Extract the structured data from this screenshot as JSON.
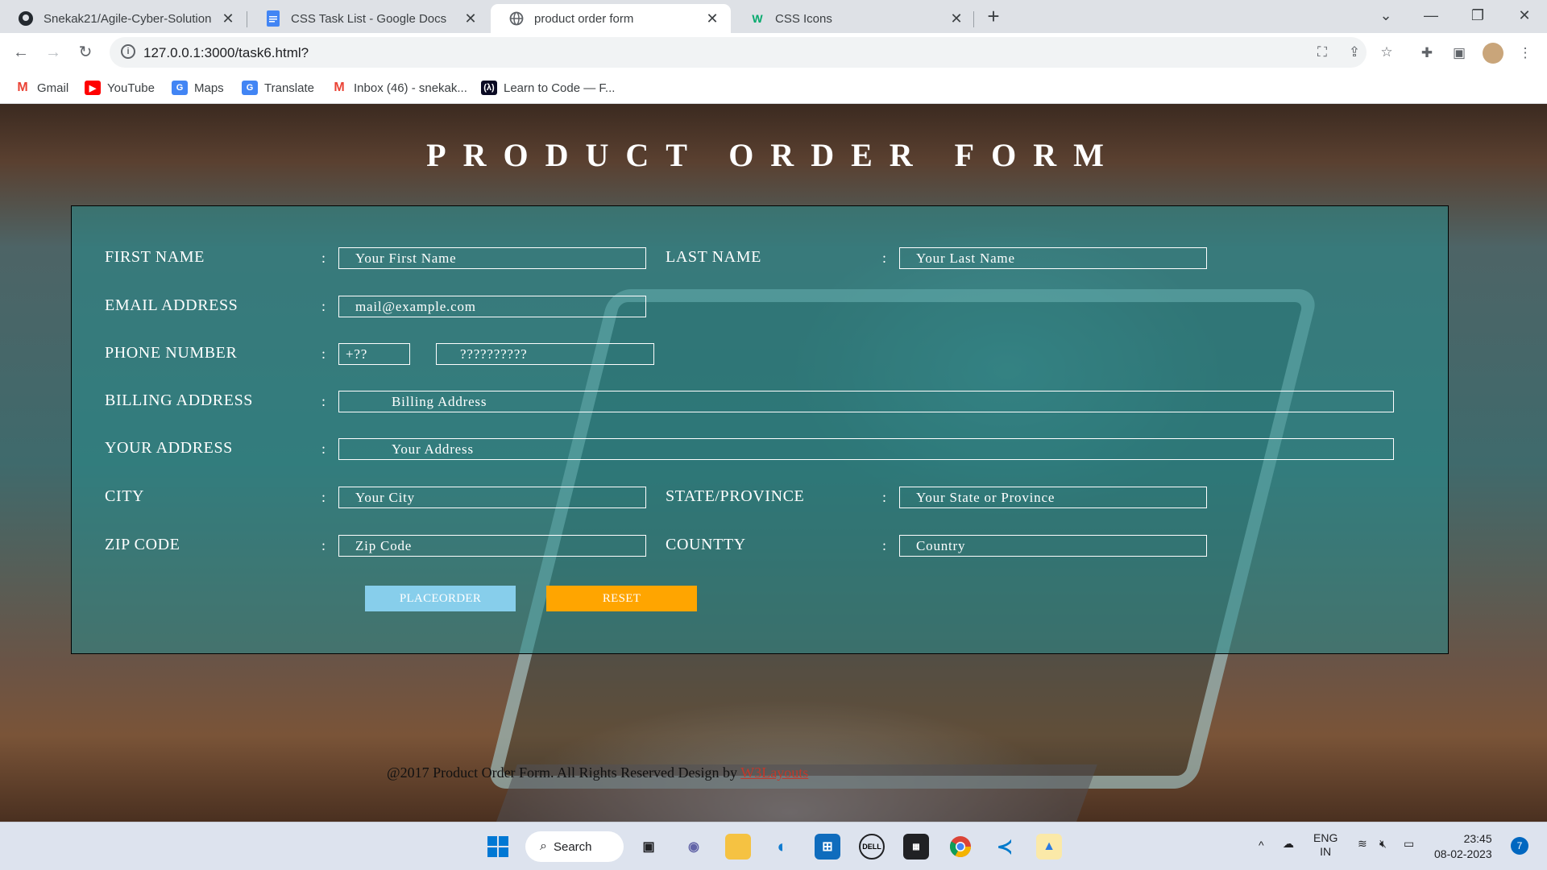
{
  "browser": {
    "tabs": [
      {
        "title": "Snekak21/Agile-Cyber-Solution",
        "icon": "github-icon",
        "active": false
      },
      {
        "title": "CSS Task List - Google Docs",
        "icon": "docs-icon",
        "active": false
      },
      {
        "title": "product order form",
        "icon": "globe-icon",
        "active": true
      },
      {
        "title": "CSS Icons",
        "icon": "w3schools-icon",
        "active": false
      }
    ],
    "url": "127.0.0.1:3000/task6.html?",
    "bookmarks": [
      {
        "label": "Gmail",
        "icon": "gmail-icon",
        "color": "#ea4335"
      },
      {
        "label": "YouTube",
        "icon": "youtube-icon",
        "color": "#ff0000"
      },
      {
        "label": "Maps",
        "icon": "maps-icon",
        "color": "#4285f4"
      },
      {
        "label": "Translate",
        "icon": "translate-icon",
        "color": "#4285f4"
      },
      {
        "label": "Inbox (46) - snekak...",
        "icon": "gmail-icon",
        "color": "#ea4335"
      },
      {
        "label": "Learn to Code — F...",
        "icon": "freecodecamp-icon",
        "color": "#0a0a23"
      }
    ]
  },
  "page": {
    "title": "PRODUCT ORDER FORM",
    "fields": {
      "first_name": {
        "label": "FIRST NAME",
        "placeholder": "Your First Name"
      },
      "last_name": {
        "label": "LAST NAME",
        "placeholder": "Your Last Name"
      },
      "email": {
        "label": "EMAIL ADDRESS",
        "placeholder": "mail@example.com"
      },
      "phone": {
        "label": "PHONE NUMBER",
        "code_placeholder": "+??",
        "number_placeholder": "??????????"
      },
      "billing": {
        "label": "BILLING ADDRESS",
        "placeholder": "Billing Address"
      },
      "address": {
        "label": "YOUR ADDRESS",
        "placeholder": "Your Address"
      },
      "city": {
        "label": "CITY",
        "placeholder": "Your City"
      },
      "state": {
        "label": "STATE/PROVINCE",
        "placeholder": "Your State or Province"
      },
      "zip": {
        "label": "ZIP CODE",
        "placeholder": "Zip Code"
      },
      "country": {
        "label": "COUNTTY",
        "placeholder": "Country"
      }
    },
    "colon": ":",
    "buttons": {
      "place_order": "PLACEORDER",
      "reset": "RESET"
    },
    "colors": {
      "place_order": "#87ceeb",
      "reset": "#ffa500"
    },
    "footer": {
      "text": "@2017 Product Order Form. All Rights Reserved Design by ",
      "link": "W3Layouts"
    }
  },
  "taskbar": {
    "search_label": "Search",
    "lang_top": "ENG",
    "lang_bottom": "IN",
    "time": "23:45",
    "date": "08-02-2023",
    "notification_count": "7"
  }
}
